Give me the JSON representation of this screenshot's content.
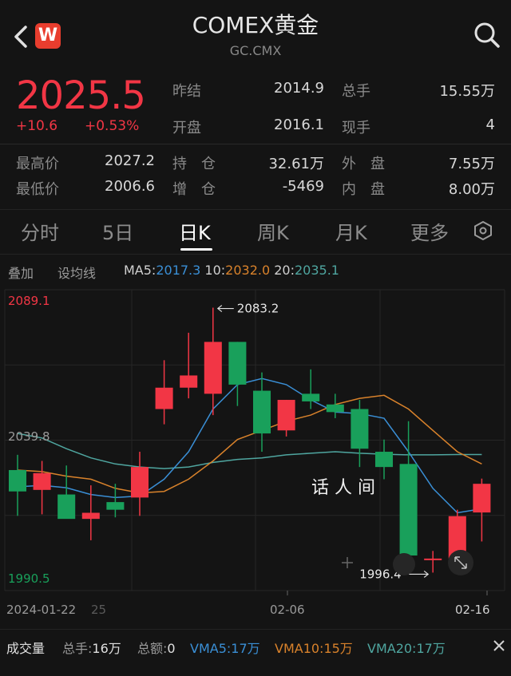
{
  "header": {
    "title": "COMEX黄金",
    "subtitle": "GC.CMX",
    "logo_letter": "W"
  },
  "quote": {
    "price": "2025.5",
    "change": "+10.6",
    "change_pct": "+0.53%",
    "stats": [
      {
        "label": "昨结",
        "value": "2014.9"
      },
      {
        "label": "总手",
        "value": "15.55万"
      },
      {
        "label": "开盘",
        "value": "2016.1"
      },
      {
        "label": "现手",
        "value": "4"
      },
      {
        "label": "最高价",
        "value": "2027.2"
      },
      {
        "label": "持　仓",
        "value": "32.61万"
      },
      {
        "label": "外　盘",
        "value": "7.55万"
      },
      {
        "label": "最低价",
        "value": "2006.6"
      },
      {
        "label": "增　仓",
        "value": "-5469"
      },
      {
        "label": "内　盘",
        "value": "8.00万"
      }
    ]
  },
  "tabs": [
    "分时",
    "5日",
    "日K",
    "周K",
    "月K",
    "更多"
  ],
  "ma_row": {
    "overlay": "叠加",
    "set_ma": "设均线",
    "ma5_label": "MA5:",
    "ma5_value": "2017.3",
    "ma10_label": "10:",
    "ma10_value": "2032.0",
    "ma20_label": "20:",
    "ma20_value": "2035.1"
  },
  "colors": {
    "up": "#f23645",
    "down": "#19a05b",
    "ma5": "#3a8fd6",
    "ma10": "#d9822b",
    "ma20": "#4fa6a0"
  },
  "chart_data": {
    "type": "candlestick",
    "y_top_label": "2089.1",
    "y_mid_label": "2039.8",
    "y_bottom_label": "1990.5",
    "ylim": [
      1990.5,
      2089.1
    ],
    "high_annotation": "2083.2",
    "low_annotation": "1996.4",
    "x_labels": [
      "2024-01-22",
      "02-06",
      "02-16"
    ],
    "x_label_fragment": "25",
    "watermark": "话 人 间",
    "candles": [
      {
        "o": 2030.0,
        "h": 2035.0,
        "l": 2015.0,
        "c": 2023.0
      },
      {
        "o": 2023.5,
        "h": 2033.0,
        "l": 2015.5,
        "c": 2029.0
      },
      {
        "o": 2022.0,
        "h": 2031.5,
        "l": 2016.0,
        "c": 2014.0
      },
      {
        "o": 2014.0,
        "h": 2025.0,
        "l": 2007.0,
        "c": 2016.0
      },
      {
        "o": 2019.5,
        "h": 2025.5,
        "l": 2014.5,
        "c": 2017.0
      },
      {
        "o": 2021.0,
        "h": 2036.0,
        "l": 2015.0,
        "c": 2031.0
      },
      {
        "o": 2050.0,
        "h": 2066.0,
        "l": 2045.0,
        "c": 2057.0
      },
      {
        "o": 2057.0,
        "h": 2075.0,
        "l": 2053.5,
        "c": 2061.0
      },
      {
        "o": 2055.0,
        "h": 2083.2,
        "l": 2048.0,
        "c": 2072.0
      },
      {
        "o": 2072.0,
        "h": 2072.0,
        "l": 2051.0,
        "c": 2058.0
      },
      {
        "o": 2056.0,
        "h": 2062.0,
        "l": 2036.0,
        "c": 2042.0
      },
      {
        "o": 2043.0,
        "h": 2053.0,
        "l": 2041.0,
        "c": 2053.0
      },
      {
        "o": 2055.0,
        "h": 2063.0,
        "l": 2050.0,
        "c": 2052.5
      },
      {
        "o": 2051.5,
        "h": 2055.0,
        "l": 2047.0,
        "c": 2049.0
      },
      {
        "o": 2050.0,
        "h": 2053.0,
        "l": 2031.0,
        "c": 2037.0
      },
      {
        "o": 2036.0,
        "h": 2040.0,
        "l": 2027.0,
        "c": 2031.0
      },
      {
        "o": 2032.0,
        "h": 2046.0,
        "l": 1998.0,
        "c": 2002.0
      },
      {
        "o": 2001.0,
        "h": 2003.5,
        "l": 1996.4,
        "c": 2001.0
      },
      {
        "o": 2001.0,
        "h": 2017.0,
        "l": 1998.5,
        "c": 2014.9
      },
      {
        "o": 2016.1,
        "h": 2027.2,
        "l": 2006.6,
        "c": 2025.5
      }
    ],
    "ma5": [
      2024.5,
      2025.0,
      2024.2,
      2022.0,
      2021.0,
      2021.5,
      2027.0,
      2036.0,
      2050.0,
      2058.0,
      2060.0,
      2058.0,
      2053.0,
      2049.0,
      2048.5,
      2047.0,
      2036.0,
      2024.0,
      2016.0,
      2017.3
    ],
    "ma10": [
      2030.0,
      2029.5,
      2028.0,
      2027.0,
      2024.0,
      2022.5,
      2023.0,
      2027.0,
      2033.0,
      2040.0,
      2043.0,
      2046.0,
      2048.0,
      2051.5,
      2053.5,
      2054.5,
      2050.0,
      2043.0,
      2036.0,
      2032.0
    ],
    "ma20": [
      2042.0,
      2040.5,
      2037.0,
      2034.0,
      2032.0,
      2031.0,
      2030.5,
      2031.0,
      2032.5,
      2033.5,
      2034.0,
      2035.0,
      2035.5,
      2036.0,
      2035.5,
      2035.2,
      2035.0,
      2035.0,
      2035.1,
      2035.1
    ]
  },
  "volume_row": {
    "title": "成交量",
    "total_hands_label": "总手:",
    "total_hands": "16万",
    "total_amount_label": "总额:",
    "total_amount": "0",
    "vma5": "VMA5:17万",
    "vma10": "VMA10:15万",
    "vma20": "VMA20:17万"
  }
}
